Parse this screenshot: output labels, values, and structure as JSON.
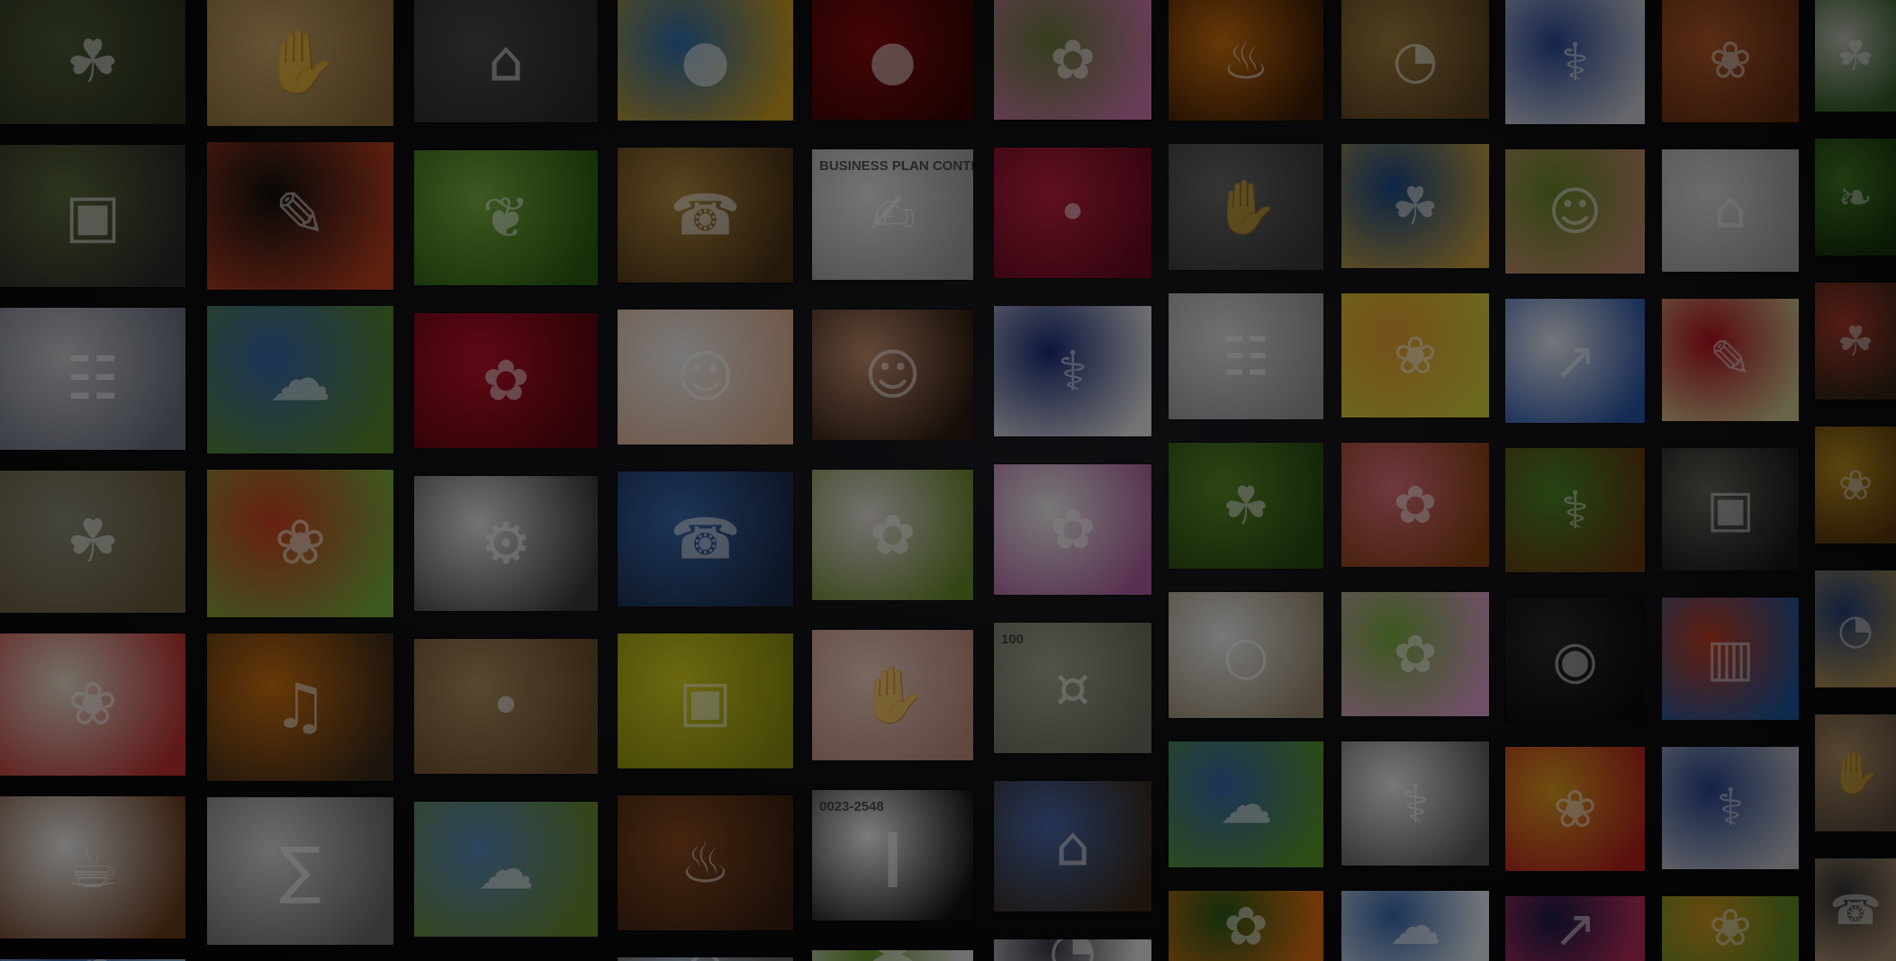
{
  "wall": {
    "tiles": [
      {
        "subject": "grass-field",
        "colors": [
          "#4d5a3a",
          "#2b3320"
        ],
        "icon": "☘",
        "caption": ""
      },
      {
        "subject": "hand-with-paper",
        "colors": [
          "#c9a86a",
          "#8a6a3a"
        ],
        "icon": "✋",
        "caption": ""
      },
      {
        "subject": "lock",
        "colors": [
          "#4a4a4a",
          "#2a2a2a"
        ],
        "icon": "⌂",
        "caption": ""
      },
      {
        "subject": "plastic-caps",
        "colors": [
          "#2f6fb0",
          "#d0a020"
        ],
        "icon": "●",
        "caption": ""
      },
      {
        "subject": "red-ornament",
        "colors": [
          "#8a0a0a",
          "#3a0505"
        ],
        "icon": "●",
        "caption": ""
      },
      {
        "subject": "pink-daisy",
        "colors": [
          "#6a7a3a",
          "#d07ab0"
        ],
        "icon": "✿",
        "caption": ""
      },
      {
        "subject": "fire",
        "colors": [
          "#d07010",
          "#3a1a05"
        ],
        "icon": "♨",
        "caption": ""
      },
      {
        "subject": "barometer",
        "colors": [
          "#a08040",
          "#5a4020"
        ],
        "icon": "◔",
        "caption": ""
      },
      {
        "subject": "doctor-clipboard",
        "colors": [
          "#2a4a9a",
          "#d8d8e0"
        ],
        "icon": "⚕",
        "caption": ""
      },
      {
        "subject": "perfume-bottle",
        "colors": [
          "#c06030",
          "#6a3010"
        ],
        "icon": "❀",
        "caption": ""
      },
      {
        "subject": "herbs",
        "colors": [
          "#d8dad0",
          "#3a6a2a"
        ],
        "icon": "☘",
        "caption": ""
      },
      {
        "subject": "photographer",
        "colors": [
          "#5a6a3a",
          "#2a2a2a"
        ],
        "icon": "▣",
        "caption": ""
      },
      {
        "subject": "colored-pencils",
        "colors": [
          "#101010",
          "#c04020"
        ],
        "icon": "✎",
        "caption": ""
      },
      {
        "subject": "green-leaf-drop",
        "colors": [
          "#7ab040",
          "#2a6010"
        ],
        "icon": "❦",
        "caption": ""
      },
      {
        "subject": "vintage-radio",
        "colors": [
          "#b08a40",
          "#4a3015"
        ],
        "icon": "☎",
        "caption": ""
      },
      {
        "subject": "business-plan-contract",
        "colors": [
          "#e8e8e8",
          "#a0a0a0"
        ],
        "icon": "✍",
        "caption": "BUSINESS PLAN   CONTRACT"
      },
      {
        "subject": "raspberries",
        "colors": [
          "#c02040",
          "#6a0a20"
        ],
        "icon": "•",
        "caption": ""
      },
      {
        "subject": "hand-with-coins",
        "colors": [
          "#6a6a6a",
          "#3a3a3a"
        ],
        "icon": "✋",
        "caption": ""
      },
      {
        "subject": "plant-sprout",
        "colors": [
          "#1a4a8a",
          "#c8a040"
        ],
        "icon": "☘",
        "caption": ""
      },
      {
        "subject": "woman-portrait",
        "colors": [
          "#6a8a2a",
          "#c89070"
        ],
        "icon": "☺",
        "caption": ""
      },
      {
        "subject": "blueprints",
        "colors": [
          "#e8e8e8",
          "#b0b0b0"
        ],
        "icon": "⌂",
        "caption": ""
      },
      {
        "subject": "cucumbers",
        "colors": [
          "#4a8a2a",
          "#1a3a0a"
        ],
        "icon": "❧",
        "caption": ""
      },
      {
        "subject": "newspapers",
        "colors": [
          "#c8ccd0",
          "#6a7080"
        ],
        "icon": "☷",
        "caption": ""
      },
      {
        "subject": "meadow-sky",
        "colors": [
          "#3a6ab0",
          "#5a8a2a"
        ],
        "icon": "☁",
        "caption": ""
      },
      {
        "subject": "red-rose",
        "colors": [
          "#c0102a",
          "#5a0510"
        ],
        "icon": "✿",
        "caption": ""
      },
      {
        "subject": "baby-towel",
        "colors": [
          "#f0f0f0",
          "#e0b090"
        ],
        "icon": "☺",
        "caption": ""
      },
      {
        "subject": "woman-face",
        "colors": [
          "#c89070",
          "#2a1a10"
        ],
        "icon": "☺",
        "caption": ""
      },
      {
        "subject": "doctor-mask",
        "colors": [
          "#1a2a7a",
          "#e8e8e8"
        ],
        "icon": "⚕",
        "caption": ""
      },
      {
        "subject": "open-book",
        "colors": [
          "#e0e0e0",
          "#9a9a9a"
        ],
        "icon": "☷",
        "caption": ""
      },
      {
        "subject": "herbal-jars",
        "colors": [
          "#e8a030",
          "#d8d040"
        ],
        "icon": "❀",
        "caption": ""
      },
      {
        "subject": "rising-chart",
        "colors": [
          "#f0f0f8",
          "#2a5ab0"
        ],
        "icon": "↗",
        "caption": ""
      },
      {
        "subject": "notepad-measuring-tape",
        "colors": [
          "#c01020",
          "#e8e0a0"
        ],
        "icon": "✎",
        "caption": ""
      },
      {
        "subject": "hands-soil-sprout",
        "colors": [
          "#c04030",
          "#3a2a1a"
        ],
        "icon": "☘",
        "caption": ""
      },
      {
        "subject": "wheat-field",
        "colors": [
          "#8a8a7a",
          "#6a5a3a"
        ],
        "icon": "☘",
        "caption": ""
      },
      {
        "subject": "vegetable-salad",
        "colors": [
          "#d04020",
          "#7ab040"
        ],
        "icon": "❀",
        "caption": ""
      },
      {
        "subject": "machine-parts",
        "colors": [
          "#e8e8e8",
          "#3a3a3a"
        ],
        "icon": "⚙",
        "caption": ""
      },
      {
        "subject": "call-center-agent",
        "colors": [
          "#3a6ab0",
          "#1a2a4a"
        ],
        "icon": "☎",
        "caption": ""
      },
      {
        "subject": "white-blossoms",
        "colors": [
          "#e8e0e0",
          "#6a8a2a"
        ],
        "icon": "✿",
        "caption": ""
      },
      {
        "subject": "white-orchid",
        "colors": [
          "#f0f0f0",
          "#b060a0"
        ],
        "icon": "✿",
        "caption": ""
      },
      {
        "subject": "grass-blades",
        "colors": [
          "#5a8a2a",
          "#2a4a10"
        ],
        "icon": "☘",
        "caption": ""
      },
      {
        "subject": "gerbera-macro",
        "colors": [
          "#e07080",
          "#8a4010"
        ],
        "icon": "✿",
        "caption": ""
      },
      {
        "subject": "medicine-bottle",
        "colors": [
          "#4a8a2a",
          "#6a3a10"
        ],
        "icon": "⚕",
        "caption": ""
      },
      {
        "subject": "photo-frame",
        "colors": [
          "#6a6a60",
          "#1a1a1a"
        ],
        "icon": "▣",
        "caption": ""
      },
      {
        "subject": "honey-jar",
        "colors": [
          "#d0a020",
          "#6a4010"
        ],
        "icon": "❀",
        "caption": ""
      },
      {
        "subject": "ice-cream-sundae",
        "colors": [
          "#e8e0d0",
          "#c03030"
        ],
        "icon": "❀",
        "caption": ""
      },
      {
        "subject": "guitar-strings",
        "colors": [
          "#d07010",
          "#3a2a1a"
        ],
        "icon": "♫",
        "caption": ""
      },
      {
        "subject": "mushroom-basket",
        "colors": [
          "#b09060",
          "#6a4a2a"
        ],
        "icon": "•",
        "caption": ""
      },
      {
        "subject": "camera-rapeseed-field",
        "colors": [
          "#d8d020",
          "#8a9010"
        ],
        "icon": "▣",
        "caption": ""
      },
      {
        "subject": "belly-hands",
        "colors": [
          "#f0d0c0",
          "#c09080"
        ],
        "icon": "✋",
        "caption": ""
      },
      {
        "subject": "zloty-banknotes",
        "colors": [
          "#a0a890",
          "#6a7060"
        ],
        "icon": "¤",
        "caption": "100"
      },
      {
        "subject": "ring-box",
        "colors": [
          "#f0f0f0",
          "#9a8a70"
        ],
        "icon": "○",
        "caption": ""
      },
      {
        "subject": "pink-orchid",
        "colors": [
          "#7ab040",
          "#e0a0d0"
        ],
        "icon": "✿",
        "caption": ""
      },
      {
        "subject": "camera-lens",
        "colors": [
          "#2a2a2a",
          "#0a0a0a"
        ],
        "icon": "◉",
        "caption": ""
      },
      {
        "subject": "color-swatches",
        "colors": [
          "#d04020",
          "#2060b0"
        ],
        "icon": "▥",
        "caption": ""
      },
      {
        "subject": "wristwatch",
        "colors": [
          "#2a4a8a",
          "#c0a060"
        ],
        "icon": "◔",
        "caption": ""
      },
      {
        "subject": "coffee-cup-beans",
        "colors": [
          "#f0f0f0",
          "#6a3a1a"
        ],
        "icon": "☕",
        "caption": ""
      },
      {
        "subject": "calculator-pen",
        "colors": [
          "#d8d8d8",
          "#6a6a6a"
        ],
        "icon": "∑",
        "caption": ""
      },
      {
        "subject": "trees-landscape",
        "colors": [
          "#5a8ac0",
          "#6a8a2a"
        ],
        "icon": "☁",
        "caption": ""
      },
      {
        "subject": "fireplace",
        "colors": [
          "#8a4a20",
          "#3a2010"
        ],
        "icon": "♨",
        "caption": ""
      },
      {
        "subject": "barcode",
        "colors": [
          "#f8f8f8",
          "#101010"
        ],
        "icon": "❙",
        "caption": "0023-2548"
      },
      {
        "subject": "wooden-house",
        "colors": [
          "#4a6ab0",
          "#3a2a1a"
        ],
        "icon": "⌂",
        "caption": ""
      },
      {
        "subject": "green-field-sky",
        "colors": [
          "#3a6ab0",
          "#5a9a2a"
        ],
        "icon": "☁",
        "caption": ""
      },
      {
        "subject": "stethoscope-writing",
        "colors": [
          "#f0f0f0",
          "#5a5a5a"
        ],
        "icon": "⚕",
        "caption": ""
      },
      {
        "subject": "fruits-vegetables",
        "colors": [
          "#e0a020",
          "#c02020"
        ],
        "icon": "❀",
        "caption": ""
      },
      {
        "subject": "doctor-apple",
        "colors": [
          "#2a4a9a",
          "#d8d8e0"
        ],
        "icon": "⚕",
        "caption": ""
      },
      {
        "subject": "hand-with-key",
        "colors": [
          "#c8a070",
          "#6a5a4a"
        ],
        "icon": "✋",
        "caption": ""
      },
      {
        "subject": "water-sky",
        "colors": [
          "#3a6ab0",
          "#8ab0d0"
        ],
        "icon": "☁",
        "caption": ""
      },
      {
        "subject": "pink-flower",
        "colors": [
          "#d04080",
          "#6a1a3a"
        ],
        "icon": "✿",
        "caption": ""
      },
      {
        "subject": "tv-screen",
        "colors": [
          "#a0a8a0",
          "#3a3a3a"
        ],
        "icon": "▣",
        "caption": ""
      },
      {
        "subject": "castle-sky",
        "colors": [
          "#a0b0c0",
          "#6a6a6a"
        ],
        "icon": "⌂",
        "caption": ""
      },
      {
        "subject": "dandelion",
        "colors": [
          "#6a9a2a",
          "#e0e0e0"
        ],
        "icon": "✱",
        "caption": ""
      },
      {
        "subject": "businessman-watch",
        "colors": [
          "#3a3a4a",
          "#e8e8e8"
        ],
        "icon": "◔",
        "caption": ""
      },
      {
        "subject": "orange-flower",
        "colors": [
          "#2a5a1a",
          "#e07010"
        ],
        "icon": "✿",
        "caption": ""
      },
      {
        "subject": "clouds-sky",
        "colors": [
          "#3a6ab0",
          "#e0e8f0"
        ],
        "icon": "☁",
        "caption": ""
      },
      {
        "subject": "stock-ticker",
        "colors": [
          "#1a1a4a",
          "#c03060"
        ],
        "icon": "↗",
        "caption": ""
      },
      {
        "subject": "kiwi-orange",
        "colors": [
          "#e0a020",
          "#6a9a2a"
        ],
        "icon": "❀",
        "caption": ""
      },
      {
        "subject": "hand-phone",
        "colors": [
          "#3a3a3a",
          "#c0a080"
        ],
        "icon": "☎",
        "caption": ""
      }
    ]
  }
}
